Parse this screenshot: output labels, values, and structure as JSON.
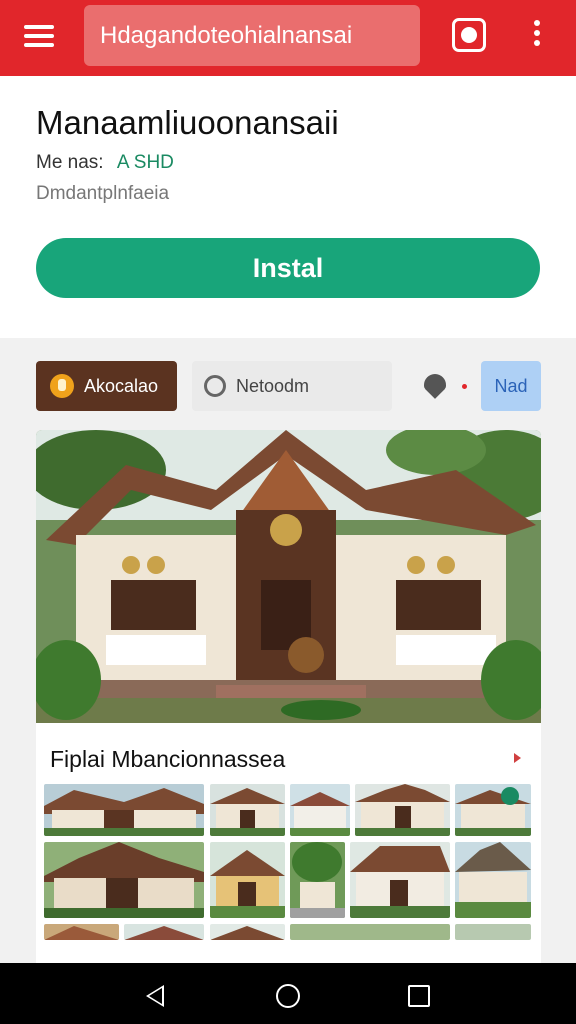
{
  "appbar": {
    "search_text": "Hdagandoteohialnansai",
    "icons": [
      "menu-icon",
      "camera-icon",
      "more-vert-icon"
    ],
    "color": "#e1262b"
  },
  "app": {
    "title": "Manaamliuoonansaii",
    "developer": "Me nas:",
    "rating": "A SHD",
    "category": "Dmdantplnfaeia",
    "install_label": "Instal",
    "install_color": "#18a57a"
  },
  "chips": {
    "primary": "Akocalao",
    "secondary": "Netoodm",
    "blue": "Nad"
  },
  "gallery": {
    "title": "Fiplai Mbancionnassea",
    "thumbnail_count": 15
  },
  "navbar": {
    "icons": [
      "back-icon",
      "home-icon",
      "recents-icon"
    ]
  }
}
